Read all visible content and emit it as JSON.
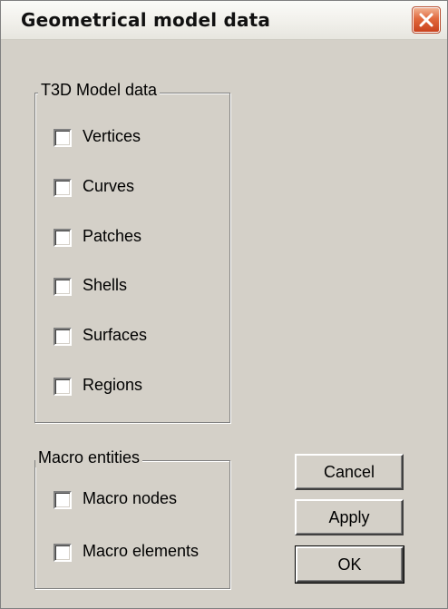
{
  "window": {
    "title": "Geometrical model data"
  },
  "t3d_group": {
    "label": "T3D Model data",
    "items": [
      {
        "label": "Vertices",
        "checked": false
      },
      {
        "label": "Curves",
        "checked": false
      },
      {
        "label": "Patches",
        "checked": false
      },
      {
        "label": "Shells",
        "checked": false
      },
      {
        "label": "Surfaces",
        "checked": false
      },
      {
        "label": "Regions",
        "checked": false
      }
    ]
  },
  "macro_group": {
    "label": "Macro entities",
    "items": [
      {
        "label": "Macro nodes",
        "checked": false
      },
      {
        "label": "Macro elements",
        "checked": false
      }
    ]
  },
  "buttons": {
    "cancel": "Cancel",
    "apply": "Apply",
    "ok": "OK"
  },
  "icons": {
    "close": "close-icon",
    "checkbox": "checkbox-unchecked"
  },
  "colors": {
    "dialog_face": "#d4d0c8",
    "close_button": "#e1693d",
    "titlebar": "#f2f1ec"
  }
}
